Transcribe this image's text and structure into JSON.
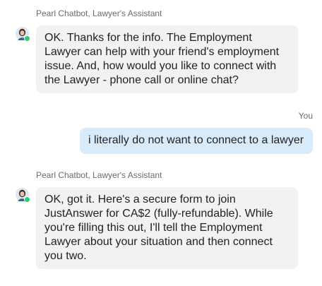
{
  "messages": [
    {
      "sender": "Pearl Chatbot, Lawyer's Assistant",
      "avatar_icon": "assistant-avatar-icon",
      "text": "OK. Thanks for the info. The Employment\nLawyer can help with your friend's employment\nissue. And, how would you like to connect with\nthe Lawyer - phone call or online chat?"
    },
    {
      "sender": "You",
      "text": "i literally do not want to connect to a lawyer"
    },
    {
      "sender": "Pearl Chatbot, Lawyer's Assistant",
      "avatar_icon": "assistant-avatar-icon",
      "text": "OK, got it. Here's a secure form to join\nJustAnswer for CA$2 (fully-refundable). While\nyou're filling this out, I'll tell the Employment\nLawyer about your situation and then connect\nyou two."
    }
  ],
  "colors": {
    "assistant_bubble": "#f1f2f4",
    "user_bubble": "#d7ebfb",
    "online_status": "#2ecc71",
    "meta_text": "#6b6b6b"
  }
}
